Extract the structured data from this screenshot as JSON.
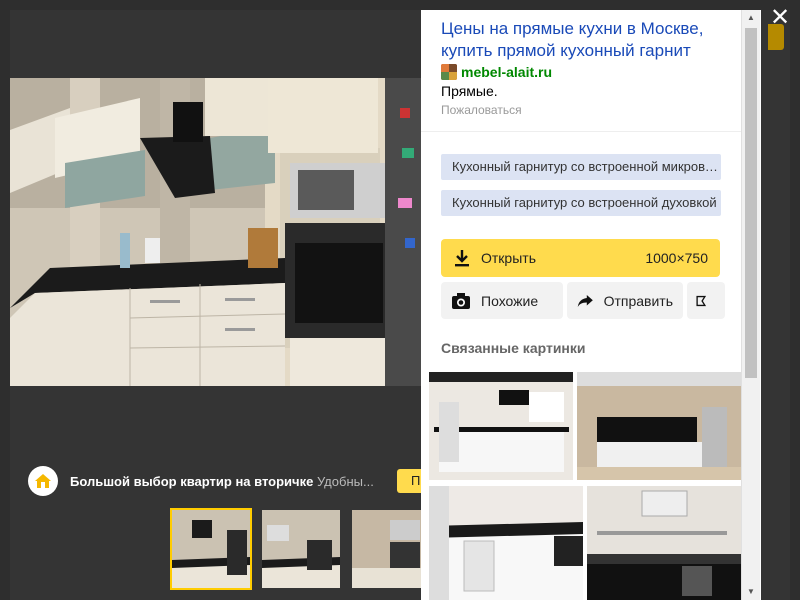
{
  "viewer": {
    "close_icon": "✕",
    "ad": {
      "title": "Большой выбор квартир на вторичке",
      "subtitle": "Удобны...",
      "button_label": "П",
      "icon": "house-icon"
    },
    "thumbnails_count": 3
  },
  "panel": {
    "title": "Цены на прямые кухни в Москве, купить прямой кухонный гарнит",
    "source": "mebel-alait.ru",
    "description": "Прямые.",
    "complain": "Пожаловаться",
    "chips": [
      "Кухонный гарнитур со встроенной микроволновкой",
      "Кухонный гарнитур со встроенной духовкой"
    ],
    "open_label": "Открыть",
    "image_size": "1000×750",
    "similar_label": "Похожие",
    "share_label": "Отправить",
    "related_title": "Связанные картинки"
  },
  "colors": {
    "accent_yellow": "#ffdb4d",
    "link_blue": "#1a4ab8",
    "source_green": "#008800",
    "chip_bg": "#dce3f3"
  }
}
